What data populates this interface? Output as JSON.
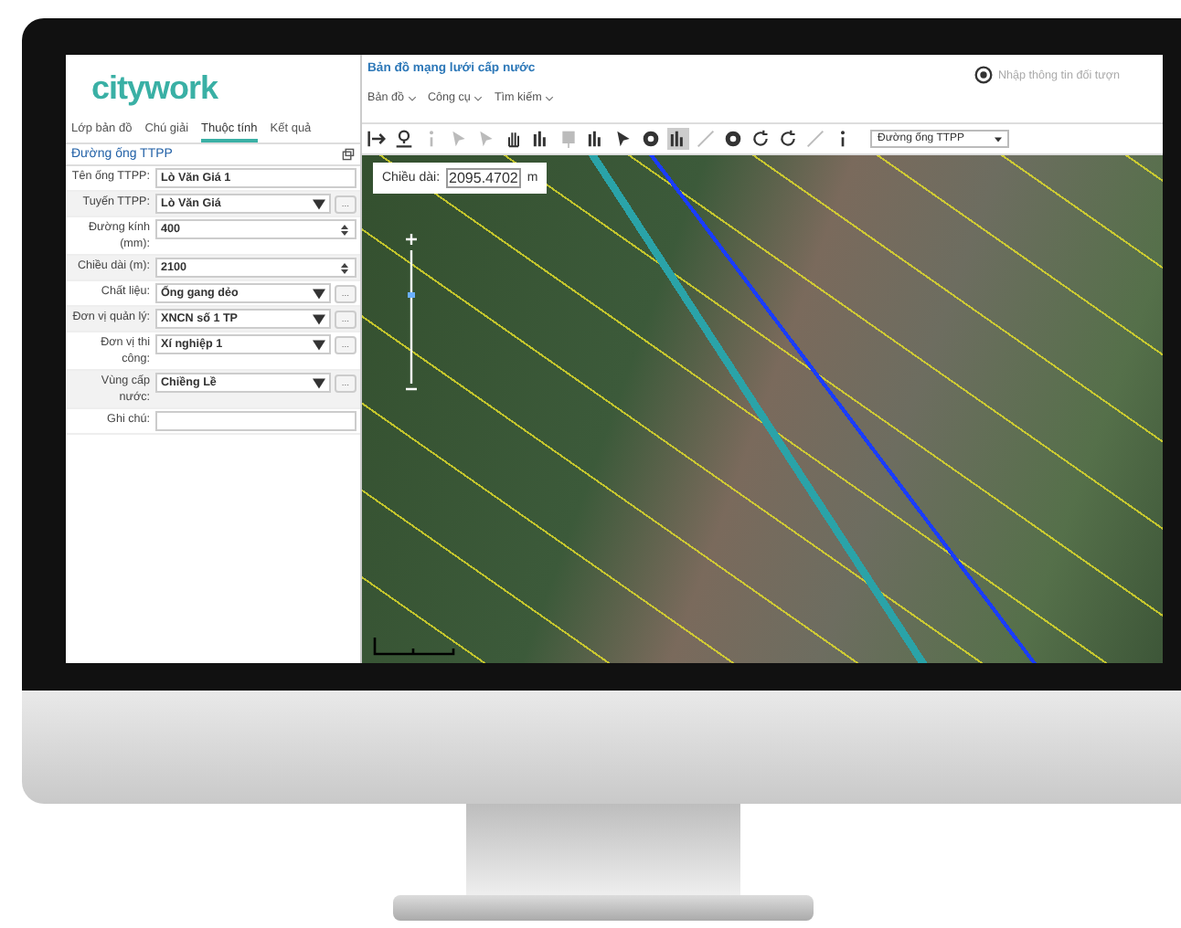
{
  "logo": "citywork",
  "tabs": [
    {
      "label": "Lớp bản đồ",
      "selected": false
    },
    {
      "label": "Chú giải",
      "selected": false
    },
    {
      "label": "Thuộc tính",
      "selected": true
    },
    {
      "label": "Kết quả",
      "selected": false
    }
  ],
  "panel": {
    "title": "Đường ống TTPP"
  },
  "fields": [
    {
      "label": "Tên ống TTPP:",
      "value": "Lò Văn Giá 1",
      "kind": "text"
    },
    {
      "label": "Tuyến TTPP:",
      "value": "Lò Văn Giá",
      "kind": "select",
      "button": "..."
    },
    {
      "label": "Đường kính (mm):",
      "value": "400",
      "kind": "number"
    },
    {
      "label": "Chiều dài (m):",
      "value": "2100",
      "kind": "number"
    },
    {
      "label": "Chất liệu:",
      "value": "Ống gang dẻo",
      "kind": "select",
      "button": "..."
    },
    {
      "label": "Đơn vị quản lý:",
      "value": "XNCN số 1 TP",
      "kind": "select",
      "button": "..."
    },
    {
      "label": "Đơn vị thi công:",
      "value": "Xí nghiệp 1",
      "kind": "select",
      "button": "..."
    },
    {
      "label": "Vùng cấp nước:",
      "value": "Chiềng Lề",
      "kind": "select",
      "button": "..."
    },
    {
      "label": "Ghi chú:",
      "kind": "text"
    }
  ],
  "header": {
    "title": "Bản đồ mạng lưới cấp nước",
    "menus": [
      "Bản đồ",
      "Công cụ",
      "Tìm kiếm"
    ],
    "search": {
      "placeholder": "Nhập thông tin đối tượn"
    }
  },
  "toolbar": [
    {
      "kind": "exit",
      "disabled": false,
      "selected": false
    },
    {
      "kind": "pin",
      "disabled": false,
      "selected": false
    },
    {
      "kind": "info",
      "disabled": true,
      "selected": false
    },
    {
      "kind": "pointer",
      "disabled": true,
      "selected": false
    },
    {
      "kind": "pointer",
      "disabled": true,
      "selected": false
    },
    {
      "kind": "hand",
      "disabled": false,
      "selected": false
    },
    {
      "kind": "bars",
      "disabled": false,
      "selected": false
    },
    {
      "kind": "square",
      "disabled": true,
      "selected": false
    },
    {
      "kind": "bars",
      "disabled": false,
      "selected": false
    },
    {
      "kind": "pointer",
      "disabled": false,
      "selected": false
    },
    {
      "kind": "dot",
      "disabled": false,
      "selected": false
    },
    {
      "kind": "bars",
      "disabled": false,
      "selected": true
    },
    {
      "kind": "line",
      "disabled": true,
      "selected": false
    },
    {
      "kind": "dot",
      "disabled": false,
      "selected": false
    },
    {
      "kind": "rotate",
      "disabled": false,
      "selected": false
    },
    {
      "kind": "rotate",
      "disabled": false,
      "selected": false
    },
    {
      "kind": "line",
      "disabled": true,
      "selected": false
    },
    {
      "kind": "info",
      "disabled": false,
      "selected": false
    }
  ],
  "layer_select": "Đường ống TTPP",
  "measure": {
    "label": "Chiều dài:",
    "value": "2095.4702",
    "unit": "m"
  }
}
